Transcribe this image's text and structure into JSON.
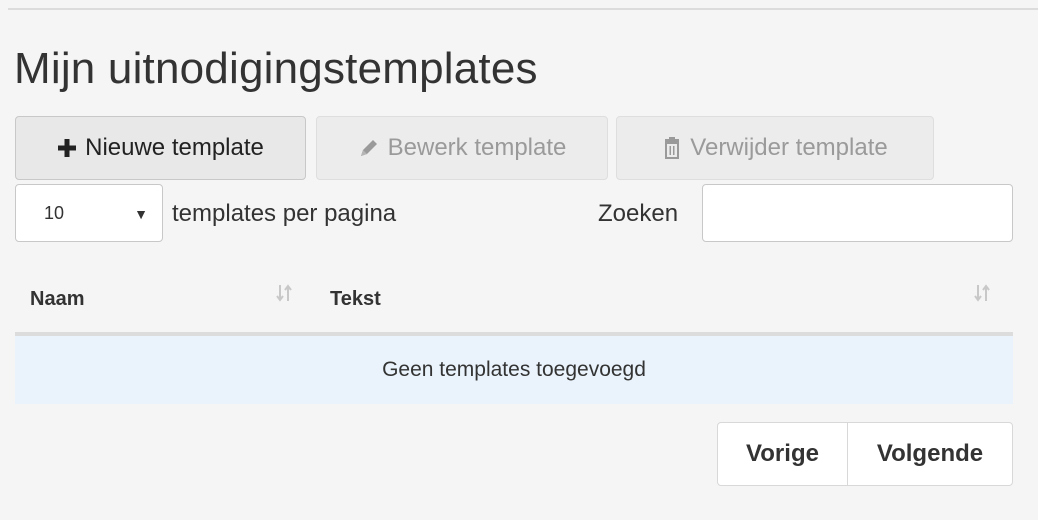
{
  "page": {
    "title": "Mijn uitnodigingstemplates"
  },
  "toolbar": {
    "new_label": "Nieuwe template",
    "edit_label": "Bewerk template",
    "delete_label": "Verwijder template"
  },
  "list_controls": {
    "page_size_value": "10",
    "page_size_label": "templates per pagina",
    "search_label": "Zoeken",
    "search_value": ""
  },
  "table": {
    "columns": [
      "Naam",
      "Tekst"
    ],
    "empty_message": "Geen templates toegevoegd"
  },
  "pagination": {
    "prev_label": "Vorige",
    "next_label": "Volgende"
  },
  "icons": {
    "new": "plus-icon",
    "edit": "pencil-icon",
    "delete": "trash-icon",
    "sort": "sort-icon",
    "select": "caret-down-icon"
  }
}
